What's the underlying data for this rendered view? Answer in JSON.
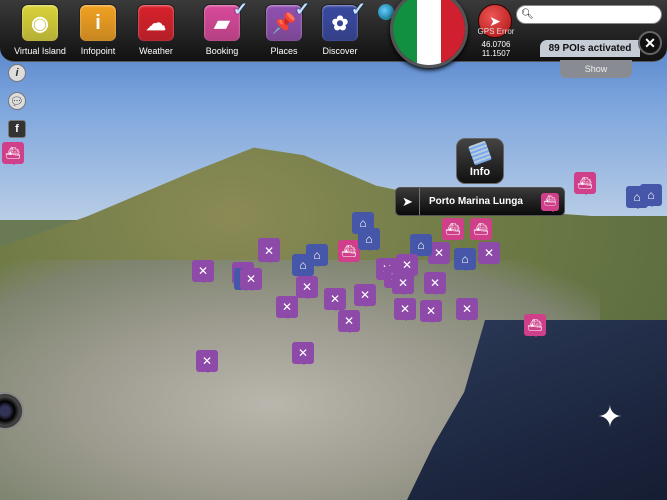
{
  "toolbar": {
    "buttons": [
      {
        "label": "Virtual Island",
        "color": "#d9d23a",
        "icon": "virtual-island-icon",
        "glyph": "◉",
        "checked": false
      },
      {
        "label": "Infopoint",
        "color": "#f0a020",
        "icon": "info-icon",
        "glyph": "i",
        "checked": false
      },
      {
        "label": "Weather",
        "color": "#d8202a",
        "icon": "weather-icon",
        "glyph": "☁",
        "checked": false
      },
      {
        "label": "Booking",
        "color": "#d8489a",
        "icon": "suitcase-icon",
        "glyph": "▰",
        "checked": true
      },
      {
        "label": "Places",
        "color": "#9050b0",
        "icon": "pushpin-icon",
        "glyph": "📌",
        "checked": true
      },
      {
        "label": "Discover",
        "color": "#3848a0",
        "icon": "compass-icon",
        "glyph": "✿",
        "checked": true
      }
    ],
    "check_glyph": "✓"
  },
  "country_flag": {
    "colors": [
      "#109040",
      "#ffffff",
      "#d02030"
    ]
  },
  "gps": {
    "label": "GPS Error",
    "lat": "46.0706",
    "lon": "11.1507"
  },
  "search": {
    "value": "",
    "placeholder": ""
  },
  "pois": {
    "status": "89 POIs activated",
    "show_label": "Show"
  },
  "info": {
    "label": "Info"
  },
  "popup": {
    "name": "Porto Marina Lunga"
  },
  "colors": {
    "restaurant": "#8d4aa8",
    "discover": "#4656a8",
    "booking": "#d0408a"
  }
}
